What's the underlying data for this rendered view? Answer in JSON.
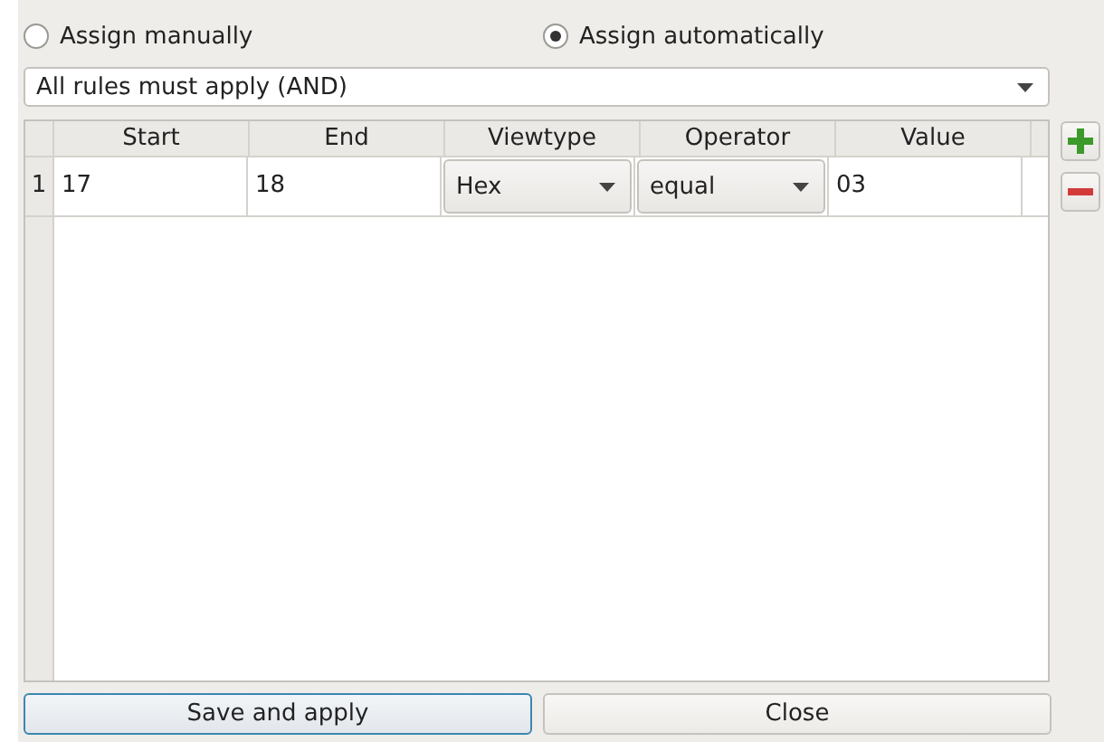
{
  "assign_modes": [
    {
      "label": "Assign manually",
      "selected": false
    },
    {
      "label": "Assign automatically",
      "selected": true
    }
  ],
  "rule_mode": {
    "value": "All rules must apply (AND)"
  },
  "table": {
    "columns": [
      "Start",
      "End",
      "Viewtype",
      "Operator",
      "Value"
    ],
    "rows": [
      {
        "number": "1",
        "cells": [
          {
            "kind": "text",
            "value": "17"
          },
          {
            "kind": "text",
            "value": "18"
          },
          {
            "kind": "combo",
            "value": "Hex"
          },
          {
            "kind": "combo",
            "value": "equal"
          },
          {
            "kind": "text",
            "value": "03"
          }
        ]
      }
    ]
  },
  "side_buttons": [
    {
      "kind": "add"
    },
    {
      "kind": "remove"
    }
  ],
  "buttons": [
    {
      "label": "Save and apply",
      "default": true
    },
    {
      "label": "Close",
      "default": false
    }
  ]
}
